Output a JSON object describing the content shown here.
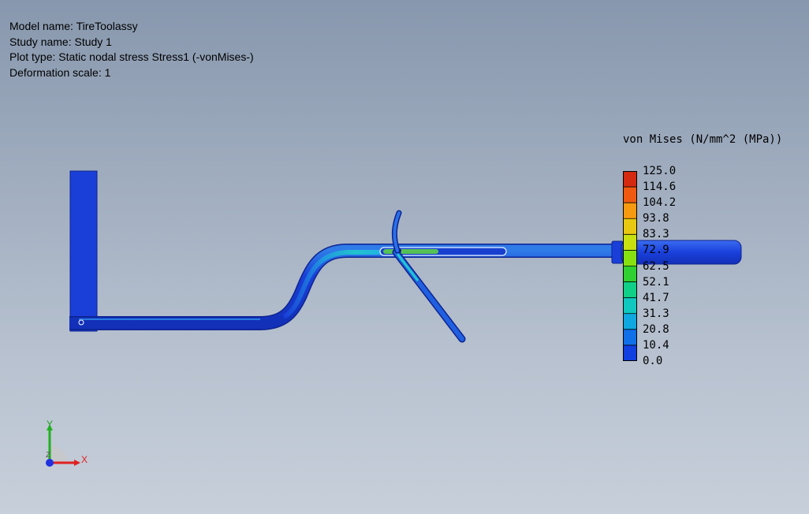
{
  "info": {
    "model_line": "Model name: TireToolassy",
    "study_line": "Study name: Study 1",
    "plot_line": "Plot type: Static nodal stress Stress1 (-vonMises-)",
    "deform_line": "Deformation scale: 1"
  },
  "legend": {
    "title": "von Mises (N/mm^2 (MPa))",
    "ticks": [
      "125.0",
      "114.6",
      "104.2",
      "93.8",
      "83.3",
      "72.9",
      "62.5",
      "52.1",
      "41.7",
      "31.3",
      "20.8",
      "10.4",
      "0.0"
    ],
    "colors": [
      "#d42a10",
      "#f05a10",
      "#f89a10",
      "#e8c810",
      "#c8e010",
      "#88e010",
      "#30d030",
      "#10d088",
      "#10c8c0",
      "#10a8e0",
      "#1070e8",
      "#1040e0"
    ]
  },
  "triad": {
    "x_label": "X",
    "y_label": "Y",
    "z_label": "Z"
  },
  "colors": {
    "model_blue": "#1a3fd8",
    "highlight_cyan": "#20c0d8",
    "highlight_green": "#40d040"
  }
}
